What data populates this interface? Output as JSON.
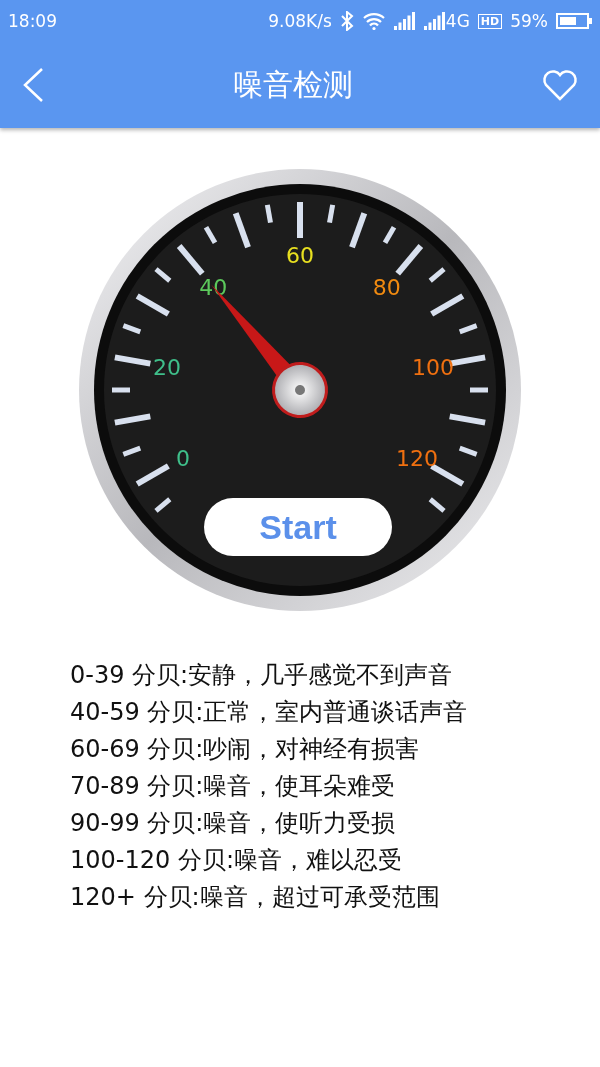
{
  "status_bar": {
    "time": "18:09",
    "speed": "9.08K/s",
    "network": "4G",
    "hd": "HD",
    "battery": "59%"
  },
  "app_bar": {
    "title": "噪音检测"
  },
  "gauge": {
    "level": 0.333,
    "button": "Start",
    "scale_labels": [
      {
        "label": "0",
        "color": "#3fbf8a"
      },
      {
        "label": "20",
        "color": "#3fbf8a"
      },
      {
        "label": "40",
        "color": "#5cc95c"
      },
      {
        "label": "60",
        "color": "#e8e020"
      },
      {
        "label": "80",
        "color": "#f08a10"
      },
      {
        "label": "100",
        "color": "#f07010"
      },
      {
        "label": "120",
        "color": "#f07010"
      }
    ]
  },
  "levels": [
    "0-39 分贝:安静，几乎感觉不到声音",
    "40-59 分贝:正常，室内普通谈话声音",
    "60-69 分贝:吵闹，对神经有损害",
    "70-89 分贝:噪音，使耳朵难受",
    "90-99 分贝:噪音，使听力受损",
    "100-120 分贝:噪音，难以忍受",
    "120+ 分贝:噪音，超过可承受范围"
  ]
}
